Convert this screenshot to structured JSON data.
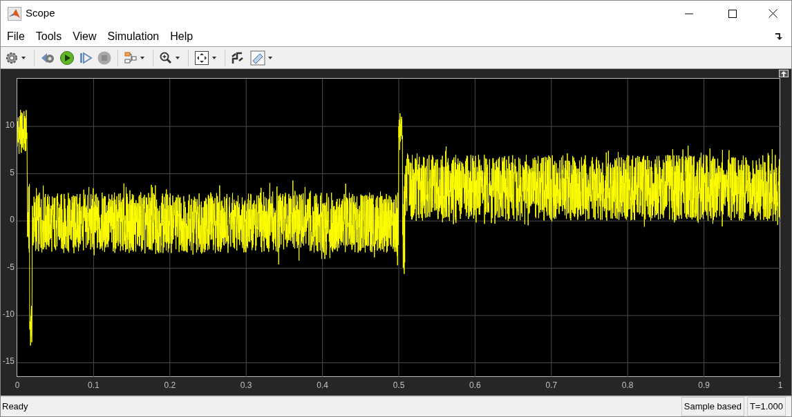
{
  "window": {
    "title": "Scope"
  },
  "menu": [
    {
      "label": "File"
    },
    {
      "label": "Tools"
    },
    {
      "label": "View"
    },
    {
      "label": "Simulation"
    },
    {
      "label": "Help"
    }
  ],
  "plot": {
    "y_ticks": [
      "10",
      "5",
      "0",
      "-5",
      "-10",
      "-15"
    ],
    "x_ticks": [
      "0",
      "0.1",
      "0.2",
      "0.3",
      "0.4",
      "0.5",
      "0.6",
      "0.7",
      "0.8",
      "0.9",
      "1"
    ]
  },
  "status_bar": {
    "message": "Ready",
    "mode": "Sample based",
    "time": "T=1.000"
  }
}
